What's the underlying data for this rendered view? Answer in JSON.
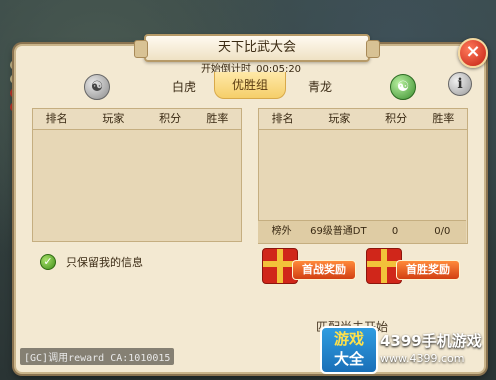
{
  "window": {
    "title": "天下比武大会",
    "close_label": "×"
  },
  "countdown": {
    "label": "开始倒计时",
    "time": "00:05:20"
  },
  "teams": {
    "left_name": "白虎",
    "group_label": "优胜组",
    "right_name": "青龙",
    "info_label": "i"
  },
  "table": {
    "headers": [
      "排名",
      "玩家",
      "积分",
      "胜率"
    ]
  },
  "own_row": {
    "rank": "榜外",
    "player": "69级普通DT",
    "score": "0",
    "win_rate": "0/0"
  },
  "options": {
    "only_mine_label": "只保留我的信息",
    "only_mine_checked": true
  },
  "rewards": {
    "first_battle": "首战奖励",
    "first_win": "首胜奖励"
  },
  "status": {
    "match": "匹配尚未开始"
  },
  "chat": {
    "line": "[GC]调用reward CA:1010015"
  },
  "watermark": {
    "logo_line1": "游戏",
    "logo_line2": "大全",
    "site_name": "4399手机游戏",
    "site_url": "www.4399.com"
  },
  "colors": {
    "panel_bg": "#f3e9d2",
    "accent_red": "#c21f12",
    "group_gold": "#f5cf6a"
  }
}
